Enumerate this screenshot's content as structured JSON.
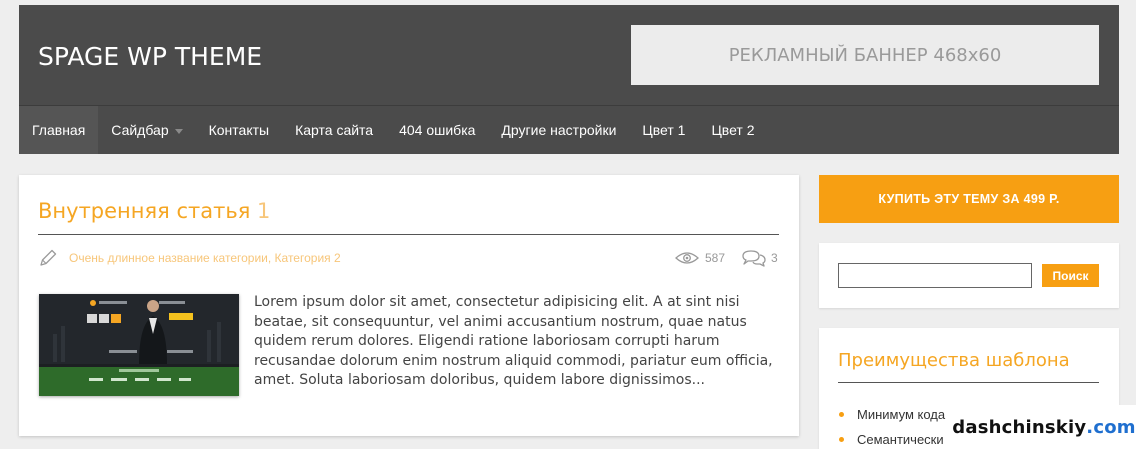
{
  "header": {
    "site_title": "SPAGE WP THEME",
    "banner_text": "РЕКЛАМНЫЙ БАННЕР 468x60"
  },
  "nav": {
    "items": [
      {
        "label": "Главная",
        "active": true
      },
      {
        "label": "Сайдбар",
        "has_dropdown": true
      },
      {
        "label": "Контакты"
      },
      {
        "label": "Карта сайта"
      },
      {
        "label": "404 ошибка"
      },
      {
        "label": "Другие настройки"
      },
      {
        "label": "Цвет 1"
      },
      {
        "label": "Цвет 2"
      }
    ]
  },
  "article": {
    "title": "Внутренняя статья",
    "title_number": "1",
    "categories": [
      "Очень длинное название категории",
      "Категория 2"
    ],
    "category_separator": ", ",
    "views": "587",
    "comments": "3",
    "excerpt": "Lorem ipsum dolor sit amet, consectetur adipisicing elit. A at sint nisi beatae, sit consequuntur, vel animi accusantium nostrum, quae natus quidem rerum dolores. Eligendi ratione laboriosam corrupti harum recusandae dolorum enim nostrum aliquid commodi, pariatur eum officia, amet. Soluta laboriosam doloribus, quidem labore dignissimos..."
  },
  "sidebar": {
    "buy_button": "КУПИТЬ ЭТУ ТЕМУ ЗА 499 Р.",
    "search": {
      "value": "",
      "button": "Поиск"
    },
    "widget": {
      "title": "Преимущества шаблона",
      "items": [
        "Минимум кода",
        "Семантически"
      ]
    }
  },
  "watermark": {
    "main": "dashchinskiy",
    "tld": ".com"
  },
  "colors": {
    "accent": "#f79f12",
    "header_bg": "#4b4b4b",
    "page_bg": "#eeeeee",
    "link_light": "#f7c67a"
  },
  "icons": [
    "pencil-icon",
    "eye-icon",
    "comment-icon",
    "dropdown-arrow-icon"
  ]
}
